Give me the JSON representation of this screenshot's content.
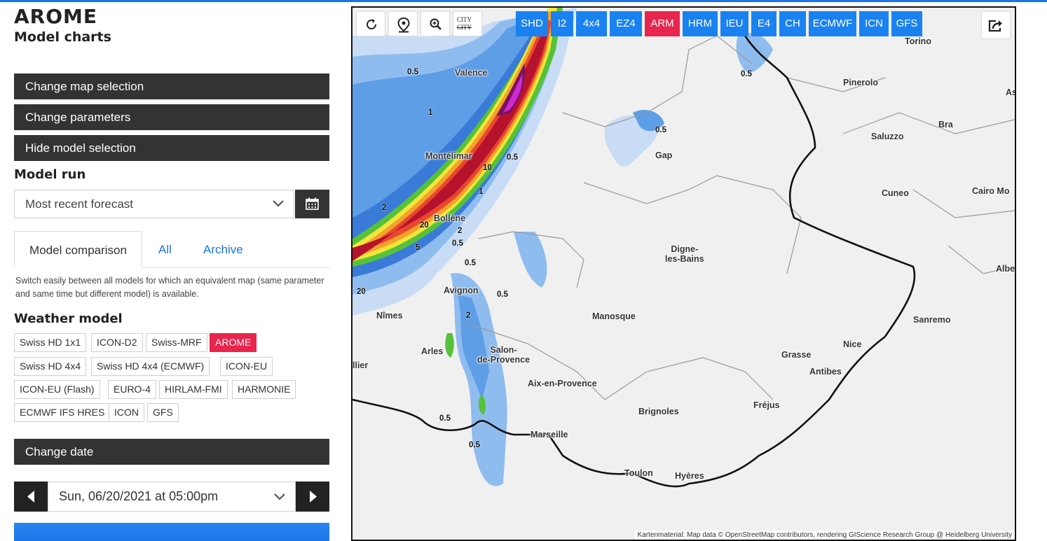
{
  "header": {
    "title": "AROME",
    "subtitle": "Model charts"
  },
  "sidebar": {
    "buttons": {
      "map_selection": "Change map selection",
      "parameters": "Change parameters",
      "hide_model": "Hide model selection",
      "change_date": "Change date"
    },
    "model_run": {
      "heading": "Model run",
      "value": "Most recent forecast"
    },
    "tabs": [
      {
        "label": "Model comparison",
        "active": true
      },
      {
        "label": "All",
        "active": false
      },
      {
        "label": "Archive",
        "active": false
      }
    ],
    "description": "Switch easily between all models for which an equivalent map (same parameter and same time but different model) is available.",
    "weather_model": {
      "heading": "Weather model",
      "chips": [
        {
          "label": "Swiss HD 1x1",
          "active": false
        },
        {
          "label": "ICON-D2",
          "active": false
        },
        {
          "label": "Swiss-MRF",
          "active": false
        },
        {
          "label": "AROME",
          "active": true
        },
        {
          "label": "Swiss HD 4x4",
          "active": false
        },
        {
          "label": "Swiss HD 4x4 (ECMWF)",
          "active": false
        },
        {
          "label": "ICON-EU",
          "active": false
        },
        {
          "label": "ICON-EU (Flash)",
          "active": false
        },
        {
          "label": "EURO-4",
          "active": false
        },
        {
          "label": "HIRLAM-FMI",
          "active": false
        },
        {
          "label": "HARMONIE",
          "active": false
        },
        {
          "label": "ECMWF IFS HRES",
          "active": false
        },
        {
          "label": "ICON",
          "active": false
        },
        {
          "label": "GFS",
          "active": false
        }
      ]
    },
    "date": {
      "value": "Sun, 06/20/2021 at 05:00pm"
    }
  },
  "map": {
    "city_toggle": {
      "line1": "CITY",
      "line2": "CITY"
    },
    "models": [
      {
        "label": "SHD",
        "active": false
      },
      {
        "label": "I2",
        "active": false
      },
      {
        "label": "4x4",
        "active": false
      },
      {
        "label": "EZ4",
        "active": false
      },
      {
        "label": "ARM",
        "active": true
      },
      {
        "label": "HRM",
        "active": false
      },
      {
        "label": "IEU",
        "active": false
      },
      {
        "label": "E4",
        "active": false
      },
      {
        "label": "CH",
        "active": false
      },
      {
        "label": "ECMWF",
        "active": false
      },
      {
        "label": "ICN",
        "active": false
      },
      {
        "label": "GFS",
        "active": false
      }
    ],
    "cities": {
      "torino": "Torino",
      "pinerolo": "Pinerolo",
      "as": "As",
      "valence": "Valence",
      "saluzzo": "Saluzzo",
      "bra": "Bra",
      "gap": "Gap",
      "montelimar": "Montélimar",
      "cuneo": "Cuneo",
      "cairo": "Cairo Mo",
      "bollene": "Bollène",
      "digne_1": "Digne-",
      "digne_2": "les-Bains",
      "albenga": "Alben",
      "avignon": "Avignon",
      "nimes": "Nîmes",
      "manosque": "Manosque",
      "sanremo": "Sanremo",
      "arles": "Arles",
      "salon_1": "Salon-",
      "salon_2": "de-Provence",
      "nice": "Nice",
      "grasse": "Grasse",
      "antibes": "Antibes",
      "llier": "llier",
      "aix": "Aix-en-Provence",
      "frejus": "Fréjus",
      "brignoles": "Brignoles",
      "marseille": "Marseille",
      "toulon": "Toulon",
      "hyeres": "Hyères"
    },
    "isolines": [
      "0.5",
      "1",
      "2",
      "5",
      "10",
      "20"
    ],
    "attribution": "Kartenmaterial: Map data © OpenStreetMap contributors, rendering GIScience Research Group @ Heidelberg University"
  },
  "colors": {
    "accent_blue": "#1a82f0",
    "active_red": "#e8254d",
    "dark_button": "#333333"
  }
}
